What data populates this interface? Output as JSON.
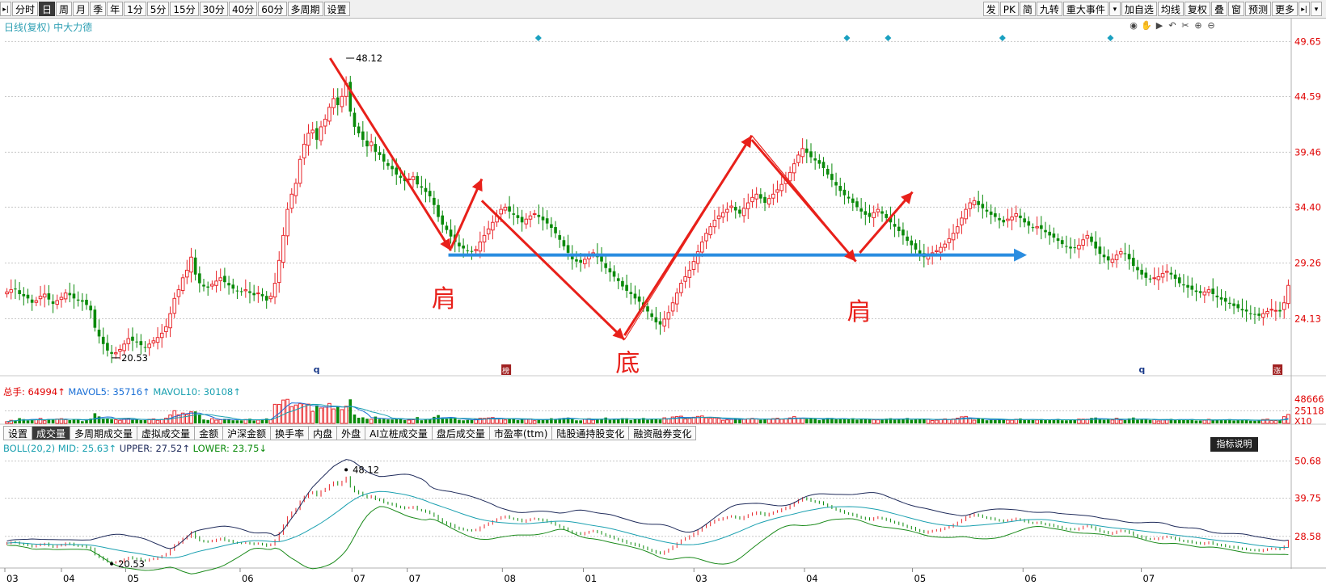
{
  "toolbar": {
    "left": [
      {
        "name": "toolbar-arrow-button",
        "label": "▸|",
        "type": "icon"
      },
      {
        "name": "tab-fenshi",
        "label": "分时"
      },
      {
        "name": "tab-ri",
        "label": "日",
        "active": true
      },
      {
        "name": "tab-zhou",
        "label": "周"
      },
      {
        "name": "tab-yue",
        "label": "月"
      },
      {
        "name": "tab-ji",
        "label": "季"
      },
      {
        "name": "tab-nian",
        "label": "年"
      },
      {
        "name": "tab-1fen",
        "label": "1分"
      },
      {
        "name": "tab-5fen",
        "label": "5分"
      },
      {
        "name": "tab-15fen",
        "label": "15分"
      },
      {
        "name": "tab-30fen",
        "label": "30分"
      },
      {
        "name": "tab-40fen",
        "label": "40分"
      },
      {
        "name": "tab-60fen",
        "label": "60分"
      },
      {
        "name": "tab-duozhouqi",
        "label": "多周期"
      },
      {
        "name": "tab-shezhi",
        "label": "设置"
      }
    ],
    "right": [
      {
        "name": "btn-fa",
        "label": "发"
      },
      {
        "name": "btn-pk",
        "label": "PK"
      },
      {
        "name": "btn-jian",
        "label": "简"
      },
      {
        "name": "btn-jiuzhuan",
        "label": "九转"
      },
      {
        "name": "btn-zhongda",
        "label": "重大事件"
      },
      {
        "name": "btn-dropdown",
        "label": "▾",
        "type": "icon"
      },
      {
        "name": "btn-jiazixuan",
        "label": "加自选"
      },
      {
        "name": "btn-junxian",
        "label": "均线"
      },
      {
        "name": "btn-fuquan",
        "label": "复权"
      },
      {
        "name": "btn-die",
        "label": "叠"
      },
      {
        "name": "btn-chuang",
        "label": "窗"
      },
      {
        "name": "btn-yuce",
        "label": "预测"
      },
      {
        "name": "btn-gengduo",
        "label": "更多"
      },
      {
        "name": "btn-panel-toggle",
        "label": "▸|",
        "type": "icon"
      },
      {
        "name": "btn-collapse",
        "label": "▾",
        "type": "icon"
      }
    ]
  },
  "stock_title": "日线(复权)  中大力德",
  "nav_icons": [
    "eye-icon",
    "hand-icon",
    "play-icon",
    "undo-icon",
    "scissors-icon",
    "zoom-in-icon",
    "zoom-out-icon"
  ],
  "colors": {
    "up": "#e8262b",
    "down": "#0a8a0a",
    "annotation": "#e8201a",
    "neckline": "#2a8de0",
    "grid": "#c8c8c8"
  },
  "chart_data": [
    {
      "type": "candlestick",
      "panel": "price",
      "ylim": [
        20.0,
        50.5
      ],
      "y_ticks": [
        "49.65",
        "44.59",
        "39.46",
        "34.40",
        "29.26",
        "24.13"
      ],
      "y_tick_values": [
        49.65,
        44.59,
        39.46,
        34.4,
        29.26,
        24.13
      ],
      "high_label": "48.12",
      "high_value": 48.12,
      "low_label": "20.53",
      "low_value": 20.53,
      "close": [
        26.6,
        26.8,
        26.9,
        26.4,
        26.2,
        26.0,
        25.6,
        25.8,
        26.2,
        26.4,
        25.9,
        25.5,
        25.8,
        26.1,
        26.5,
        26.3,
        26.0,
        25.8,
        25.7,
        25.4,
        24.9,
        23.3,
        22.5,
        21.8,
        21.2,
        20.9,
        21.0,
        21.3,
        21.8,
        22.3,
        22.1,
        22.0,
        21.7,
        21.5,
        21.8,
        22.1,
        22.4,
        22.8,
        23.4,
        24.6,
        26.0,
        26.8,
        27.9,
        28.6,
        29.8,
        28.2,
        27.4,
        27.1,
        27.0,
        27.3,
        27.6,
        27.9,
        27.5,
        27.2,
        26.9,
        26.7,
        26.6,
        26.8,
        26.5,
        26.3,
        26.5,
        26.2,
        25.8,
        26.2,
        27.4,
        29.5,
        31.8,
        34.2,
        35.6,
        36.6,
        38.8,
        40.2,
        41.2,
        41.5,
        40.6,
        41.8,
        42.5,
        43.6,
        44.4,
        43.8,
        44.6,
        45.8,
        43.2,
        41.8,
        41.2,
        40.6,
        40.0,
        40.4,
        39.5,
        39.2,
        38.6,
        38.2,
        37.9,
        37.4,
        37.1,
        36.8,
        37.0,
        37.2,
        36.5,
        36.2,
        35.8,
        35.4,
        34.6,
        33.5,
        32.8,
        32.3,
        31.7,
        31.2,
        30.8,
        30.6,
        30.4,
        30.3,
        30.5,
        31.2,
        31.8,
        32.4,
        33.0,
        33.6,
        34.2,
        34.4,
        34.0,
        33.7,
        33.4,
        33.0,
        33.3,
        33.6,
        33.8,
        33.5,
        33.2,
        32.9,
        32.5,
        32.0,
        31.4,
        30.8,
        30.2,
        29.6,
        29.4,
        29.3,
        29.6,
        29.9,
        30.2,
        29.8,
        29.4,
        28.8,
        28.4,
        28.0,
        27.6,
        27.1,
        26.7,
        26.4,
        26.0,
        25.7,
        25.2,
        24.8,
        24.3,
        23.8,
        23.6,
        24.1,
        24.7,
        25.6,
        26.5,
        27.4,
        28.0,
        28.6,
        29.4,
        30.3,
        31.2,
        32.0,
        32.6,
        33.2,
        33.6,
        33.9,
        34.2,
        34.5,
        34.1,
        33.8,
        34.3,
        34.8,
        35.3,
        35.6,
        35.2,
        34.8,
        35.2,
        35.6,
        36.0,
        36.5,
        37.0,
        37.6,
        38.4,
        39.2,
        39.8,
        39.4,
        39.0,
        38.7,
        38.4,
        38.0,
        37.4,
        36.9,
        36.4,
        35.9,
        35.5,
        35.2,
        34.8,
        34.4,
        34.0,
        33.7,
        33.5,
        33.9,
        34.2,
        33.8,
        33.4,
        33.0,
        32.6,
        32.2,
        31.8,
        31.3,
        30.9,
        30.5,
        30.1,
        29.8,
        30.0,
        30.2,
        30.4,
        30.7,
        31.0,
        31.5,
        32.0,
        32.6,
        33.4,
        34.2,
        34.8,
        35.0,
        34.6,
        34.3,
        34.0,
        33.7,
        33.5,
        33.2,
        33.0,
        33.3,
        33.5,
        33.8,
        33.4,
        33.0,
        32.7,
        32.5,
        32.6,
        32.4,
        32.1,
        31.8,
        31.6,
        31.3,
        31.0,
        30.8,
        30.6,
        30.7,
        30.9,
        31.4,
        31.8,
        31.2,
        30.6,
        30.1,
        29.8,
        29.5,
        29.6,
        30.0,
        30.3,
        30.1,
        29.6,
        29.0,
        28.6,
        28.2,
        27.9,
        27.8,
        27.9,
        28.0,
        28.3,
        28.5,
        28.2,
        27.8,
        27.4,
        27.2,
        27.0,
        26.8,
        26.6,
        26.5,
        26.6,
        26.8,
        26.4,
        26.1,
        25.9,
        25.7,
        25.5,
        25.3,
        25.1,
        24.9,
        24.8,
        24.6,
        24.5,
        24.4,
        24.6,
        24.8,
        25.0,
        24.9,
        24.8,
        25.6,
        27.2
      ],
      "x_month_labels": [
        "03",
        "04",
        "05",
        "06",
        "07",
        "07",
        "08",
        "01",
        "03",
        "04",
        "05",
        "06",
        "07"
      ],
      "markers_top": [
        "diamond",
        "diamond",
        "diamond",
        "diamond",
        "diamond"
      ],
      "bottom_markers": [
        "q",
        "榜",
        "q",
        "涨"
      ],
      "annotations": [
        {
          "text": "肩",
          "role": "left-shoulder"
        },
        {
          "text": "底",
          "role": "head-bottom"
        },
        {
          "text": "肩",
          "role": "right-shoulder"
        }
      ],
      "neckline_price": 30.0
    },
    {
      "type": "bar",
      "panel": "volume",
      "title": "总手: 64994↑  MAVOL5: 35716↑  MAVOL10: 30108↑",
      "y_ticks": [
        "48666",
        "25118"
      ],
      "unit_label": "X10",
      "series": [
        {
          "name": "总手",
          "label": "64994↑"
        },
        {
          "name": "MAVOL5",
          "label": "35716↑"
        },
        {
          "name": "MAVOL10",
          "label": "30108↑"
        }
      ]
    },
    {
      "type": "line",
      "panel": "boll",
      "title": "BOLL(20,2) MID: 25.63↑ UPPER: 27.52↑ LOWER: 23.75↓",
      "y_ticks": [
        "50.68",
        "39.75",
        "28.58"
      ],
      "high_label": "48.12",
      "low_label": "20.53",
      "series": [
        {
          "name": "MID",
          "label": "25.63↑",
          "color": "#1aa0b0"
        },
        {
          "name": "UPPER",
          "label": "27.52↑",
          "color": "#1e2a5a"
        },
        {
          "name": "LOWER",
          "label": "23.75↓",
          "color": "#1a8a1a"
        }
      ]
    }
  ],
  "volume_info": {
    "zongshou": "总手: 64994↑",
    "mavol5": "MAVOL5: 35716↑",
    "mavol10": "MAVOL10: 30108↑"
  },
  "boll_info": {
    "title": "BOLL(20,2)",
    "mid": "MID: 25.63↑",
    "upper": "UPPER: 27.52↑",
    "lower": "LOWER: 23.75↓"
  },
  "indicator_tabs": [
    {
      "name": "ind-tab-shezhi",
      "label": "设置"
    },
    {
      "name": "ind-tab-chengjiaoliang",
      "label": "成交量",
      "active": true
    },
    {
      "name": "ind-tab-duozhouqi",
      "label": "多周期成交量"
    },
    {
      "name": "ind-tab-xuni",
      "label": "虚拟成交量"
    },
    {
      "name": "ind-tab-jine",
      "label": "金额"
    },
    {
      "name": "ind-tab-hushen",
      "label": "沪深金额"
    },
    {
      "name": "ind-tab-huanshou",
      "label": "换手率"
    },
    {
      "name": "ind-tab-neipan",
      "label": "内盘"
    },
    {
      "name": "ind-tab-waipan",
      "label": "外盘"
    },
    {
      "name": "ind-tab-ai",
      "label": "AI立桩成交量"
    },
    {
      "name": "ind-tab-panhou",
      "label": "盘后成交量"
    },
    {
      "name": "ind-tab-shiying",
      "label": "市盈率(ttm)"
    },
    {
      "name": "ind-tab-lugu",
      "label": "陆股通持股变化"
    },
    {
      "name": "ind-tab-rongzi",
      "label": "融资融券变化"
    }
  ],
  "help_button": "指标说明"
}
